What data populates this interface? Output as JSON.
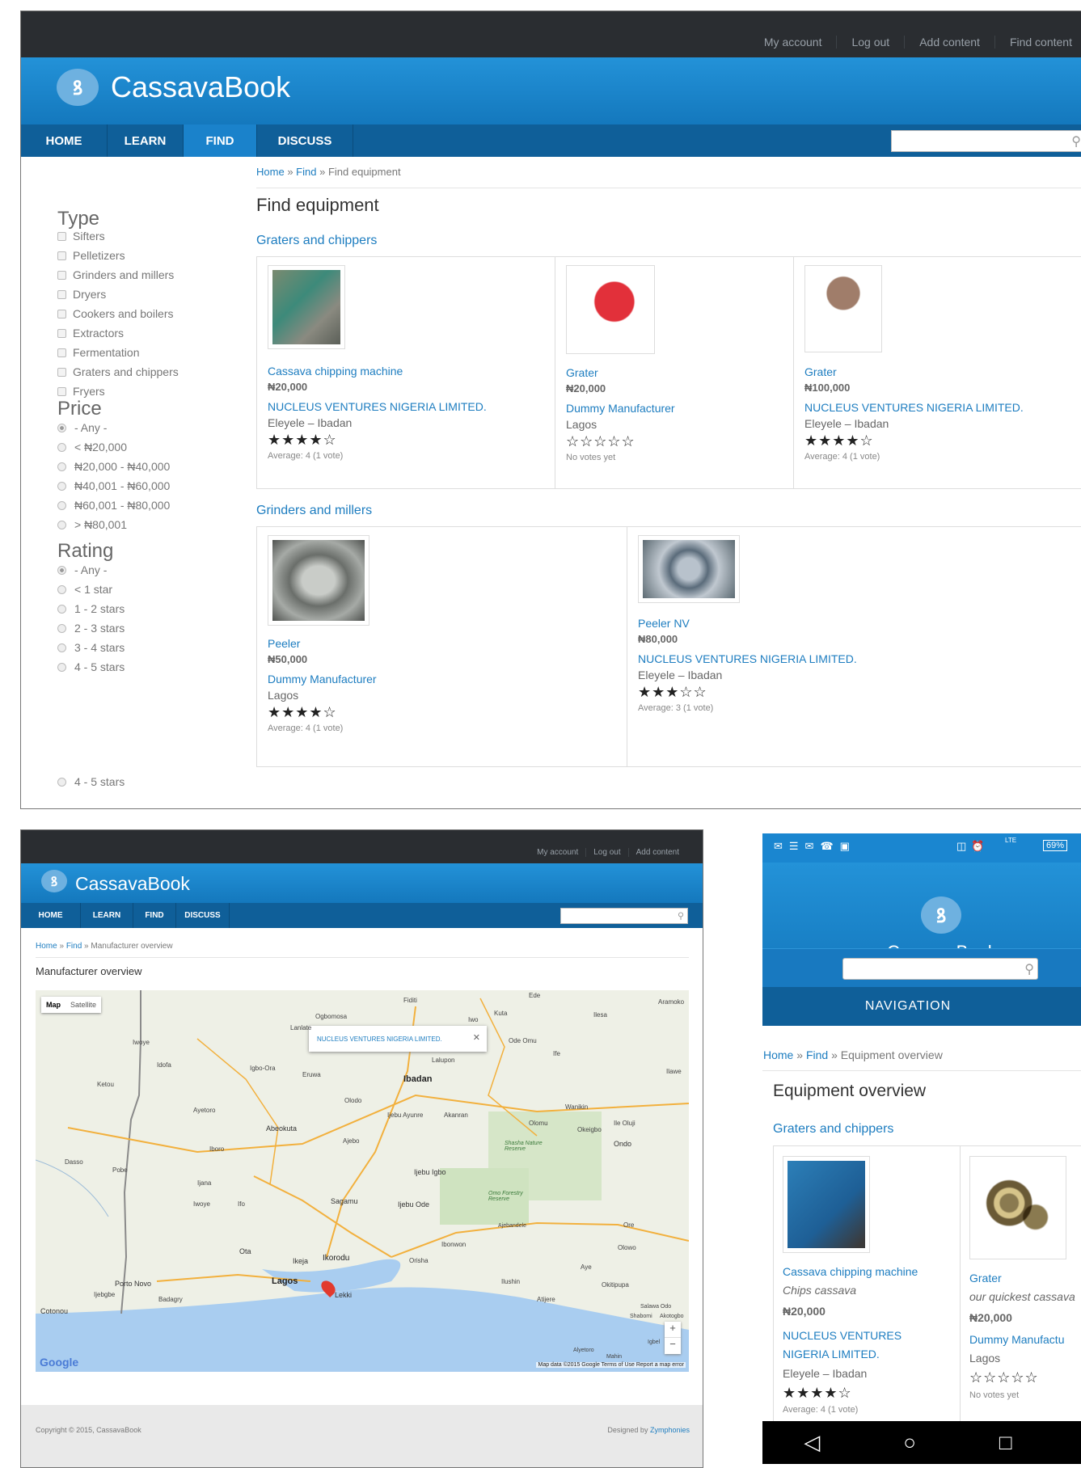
{
  "brand": {
    "name": "CassavaBook",
    "logo_letter": "ꝸ"
  },
  "top_links": [
    "My account",
    "Log out",
    "Add content",
    "Find content"
  ],
  "top_links_small": [
    "My account",
    "Log out",
    "Add content"
  ],
  "nav": [
    "HOME",
    "LEARN",
    "FIND",
    "DISCUSS"
  ],
  "desktop": {
    "breadcrumb": {
      "home": "Home",
      "sep": "»",
      "find": "Find",
      "current": "Find equipment"
    },
    "title": "Find equipment",
    "filters": {
      "type_title": "Type",
      "types": [
        "Sifters",
        "Pelletizers",
        "Grinders and millers",
        "Dryers",
        "Cookers and boilers",
        "Extractors",
        "Fermentation",
        "Graters and chippers",
        "Fryers"
      ],
      "price_title": "Price",
      "prices": [
        "- Any -",
        "< ₦20,000",
        "₦20,000 - ₦40,000",
        "₦40,001 - ₦60,000",
        "₦60,001 - ₦80,000",
        "> ₦80,001"
      ],
      "rating_title": "Rating",
      "ratings": [
        "- Any -",
        "< 1 star",
        "1 - 2 stars",
        "2 - 3 stars",
        "3 - 4 stars",
        "4 - 5 stars"
      ],
      "rating_dup": "4 - 5 stars"
    },
    "sections": [
      {
        "title": "Graters and chippers",
        "items": [
          {
            "name": "Cassava chipping machine",
            "price": "₦20,000",
            "manufacturer": "NUCLEUS VENTURES NIGERIA LIMITED.",
            "location": "Eleyele – Ibadan",
            "stars": "★★★★☆",
            "rating": 4,
            "votes": "Average: 4 (1 vote)"
          },
          {
            "name": "Grater",
            "price": "₦20,000",
            "manufacturer": "Dummy Manufacturer",
            "location": "Lagos",
            "stars": "☆☆☆☆☆",
            "rating": 0,
            "votes": "No votes yet"
          },
          {
            "name": "Grater",
            "price": "₦100,000",
            "manufacturer": "NUCLEUS VENTURES NIGERIA LIMITED.",
            "location": "Eleyele – Ibadan",
            "stars": "★★★★☆",
            "rating": 4,
            "votes": "Average: 4 (1 vote)"
          }
        ]
      },
      {
        "title": "Grinders and millers",
        "items": [
          {
            "name": "Peeler",
            "price": "₦50,000",
            "manufacturer": "Dummy Manufacturer",
            "location": "Lagos",
            "stars": "★★★★☆",
            "rating": 4,
            "votes": "Average: 4 (1 vote)"
          },
          {
            "name": "Peeler NV",
            "price": "₦80,000",
            "manufacturer": "NUCLEUS VENTURES NIGERIA LIMITED.",
            "location": "Eleyele – Ibadan",
            "stars": "★★★☆☆",
            "rating": 3,
            "votes": "Average: 3 (1 vote)"
          }
        ]
      }
    ]
  },
  "map_page": {
    "breadcrumb": {
      "home": "Home",
      "sep": "»",
      "find": "Find",
      "current": "Manufacturer overview"
    },
    "title": "Manufacturer overview",
    "map_type": [
      "Map",
      "Satellite"
    ],
    "popup": "NUCLEUS VENTURES NIGERIA LIMITED.",
    "popup_close": "✕",
    "places": [
      "Ogbomosa",
      "Fiditi",
      "Iwo",
      "Kuta",
      "Ilesa",
      "Ede",
      "Aramoko",
      "Lanlate",
      "Ode Omu",
      "Ife",
      "Iwoye",
      "Idofa",
      "Igbo-Ora",
      "Eruwa",
      "Lalupon",
      "Ibadan",
      "Ilawe",
      "Ketou",
      "Olodo",
      "Wanikin",
      "Ayetoro",
      "Abeokuta",
      "Ijebu Ayunre",
      "Akanran",
      "Olomu",
      "Okeigbo",
      "Ile Oluji",
      "Ondo",
      "Ajebo",
      "Shasha Nature Reserve",
      "Iboro",
      "Pobe",
      "Ijebu Igbo",
      "Dasso",
      "Ijana",
      "Omo Forestry Reserve",
      "Iwoye",
      "Ifo",
      "Sagamu",
      "Ijebu Ode",
      "Ore",
      "Ajebandele",
      "Ota",
      "Ikeja",
      "Ikorodu",
      "Orisha",
      "Ibonwon",
      "Olowo",
      "Lagos",
      "Lekki",
      "Ilushin",
      "Aye",
      "Okitipupa",
      "Porto Novo",
      "Ijebgbe",
      "Badagry",
      "Atijere",
      "Salawa Odo",
      "Shabomi",
      "Akotogbo",
      "Cotonou",
      "Alyetoro",
      "Igbel",
      "Mahin"
    ],
    "google": "Google",
    "attribution": "Map data ©2015 Google   Terms of Use   Report a map error",
    "zoom_in": "+",
    "zoom_out": "−",
    "footer_left": "Copyright © 2015, CassavaBook",
    "footer_right_prefix": "Designed by",
    "footer_right_link": "Zymphonies"
  },
  "mobile": {
    "status": {
      "battery": "69%",
      "lte": "LTE"
    },
    "nav_label": "NAVIGATION",
    "breadcrumb": {
      "home": "Home",
      "sep": "»",
      "find": "Find",
      "current": "Equipment overview"
    },
    "title": "Equipment overview",
    "section": "Graters and chippers",
    "items": [
      {
        "name": "Cassava chipping machine",
        "desc": "Chips cassava",
        "price": "₦20,000",
        "manufacturer": "NUCLEUS VENTURES NIGERIA LIMITED.",
        "location": "Eleyele – Ibadan",
        "stars": "★★★★☆",
        "rating": 4,
        "votes": "Average: 4 (1 vote)"
      },
      {
        "name": "Grater",
        "desc": "our quickest cassava",
        "price": "₦20,000",
        "manufacturer": "Dummy Manufactu",
        "location": "Lagos",
        "stars": "☆☆☆☆☆",
        "rating": 0,
        "votes": "No votes yet"
      }
    ],
    "softkeys": [
      "◁",
      "○",
      "□"
    ]
  },
  "colors": {
    "brand_blue": "#1a86d0",
    "nav_dark": "#0f5f99",
    "topbar": "#2a2d31",
    "link": "#1d7dc0"
  }
}
